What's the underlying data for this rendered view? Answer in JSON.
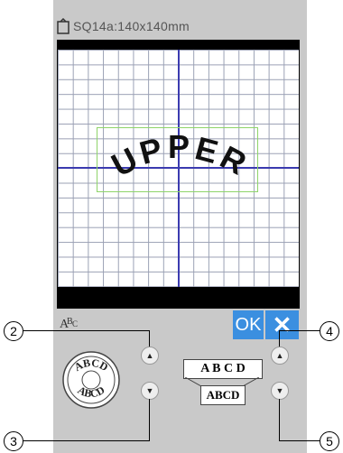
{
  "header": {
    "title": "SQ14a:140x140mm"
  },
  "canvas": {
    "text": "UPPER"
  },
  "buttons": {
    "ok": "OK",
    "cancel": "✕"
  },
  "controls": {
    "left_top": "ABCD",
    "left_bottom": "ABCD",
    "right_top": "A B C D",
    "right_bottom": "ABCD"
  },
  "callouts": [
    "2",
    "3",
    "4",
    "5"
  ],
  "colors": {
    "accent": "#3b8fe0",
    "axis": "#3b3bb0",
    "selection": "#8fd46a"
  }
}
